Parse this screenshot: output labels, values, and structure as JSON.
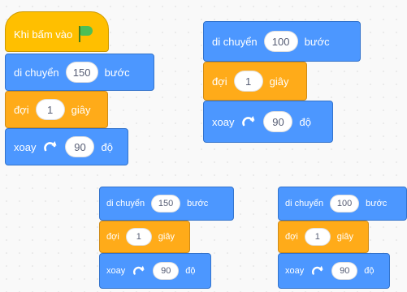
{
  "stacks": [
    {
      "hat_text": "Khi bấm vào",
      "move": {
        "label": "di chuyển",
        "value": "150",
        "unit": "bước"
      },
      "wait": {
        "label": "đợi",
        "value": "1",
        "unit": "giây"
      },
      "turn": {
        "label": "xoay",
        "value": "90",
        "unit": "độ"
      }
    },
    {
      "move": {
        "label": "di chuyển",
        "value": "100",
        "unit": "bước"
      },
      "wait": {
        "label": "đợi",
        "value": "1",
        "unit": "giây"
      },
      "turn": {
        "label": "xoay",
        "value": "90",
        "unit": "độ"
      }
    },
    {
      "move": {
        "label": "di chuyển",
        "value": "150",
        "unit": "bước"
      },
      "wait": {
        "label": "đợi",
        "value": "1",
        "unit": "giây"
      },
      "turn": {
        "label": "xoay",
        "value": "90",
        "unit": "độ"
      }
    },
    {
      "move": {
        "label": "di chuyển",
        "value": "100",
        "unit": "bước"
      },
      "wait": {
        "label": "đợi",
        "value": "1",
        "unit": "giây"
      },
      "turn": {
        "label": "xoay",
        "value": "90",
        "unit": "độ"
      }
    }
  ],
  "colors": {
    "motion": "#4C97FF",
    "control": "#FFAB19",
    "events": "#FFBF00",
    "flag": "#4CBF56"
  },
  "icons": {
    "flag": "green-flag-icon",
    "turn": "rotate-right-icon"
  }
}
